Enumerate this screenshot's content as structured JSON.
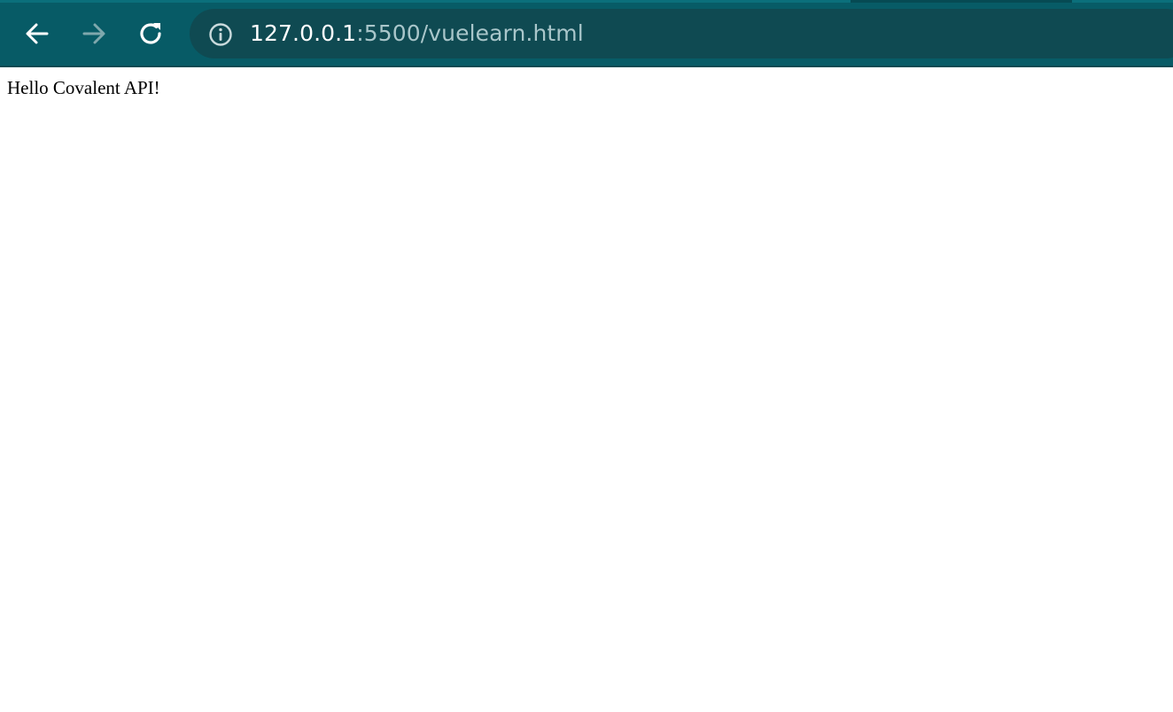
{
  "browser": {
    "url_host": "127.0.0.1",
    "url_rest": ":5500/vuelearn.html",
    "colors": {
      "toolbar": "#075b66",
      "omnibox": "#0f4a52",
      "icon_active": "#ffffff",
      "icon_disabled": "#7fa8ad",
      "url_secondary": "#a9c6ca"
    },
    "icons": {
      "back": "arrow-left",
      "forward": "arrow-right",
      "reload": "reload",
      "site_info": "info-circle"
    }
  },
  "page": {
    "text": "Hello Covalent API!"
  }
}
